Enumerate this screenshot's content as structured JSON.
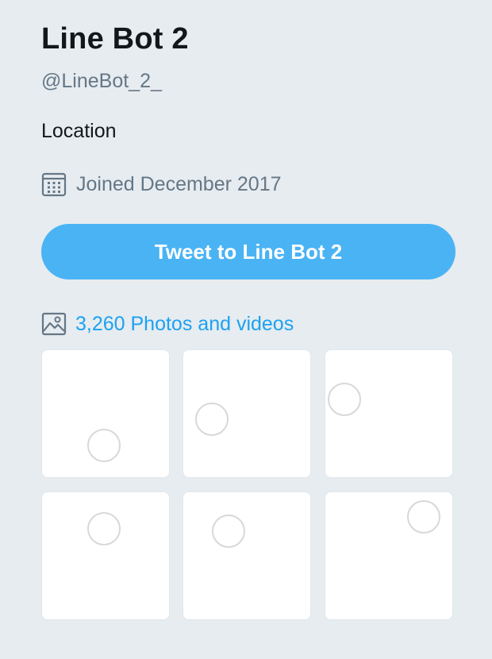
{
  "profile": {
    "name": "Line Bot 2",
    "handle": "@LineBot_2_",
    "location": "Location",
    "joined": "Joined December 2017"
  },
  "tweet_button": {
    "label": "Tweet to Line Bot 2"
  },
  "photos": {
    "link_label": "3,260 Photos and videos",
    "count": 3260,
    "thumbnails": [
      {
        "state": "loading"
      },
      {
        "state": "loading"
      },
      {
        "state": "loading"
      },
      {
        "state": "loading"
      },
      {
        "state": "loading"
      },
      {
        "state": "loading"
      }
    ]
  },
  "colors": {
    "background": "#e6ecf0",
    "accent": "#1da1f2",
    "button": "#4ab3f4",
    "secondary_text": "#657786"
  },
  "icons": {
    "joined": "calendar-icon",
    "photos": "image-icon",
    "thumbnail_loading": "loading-spinner-icon"
  }
}
